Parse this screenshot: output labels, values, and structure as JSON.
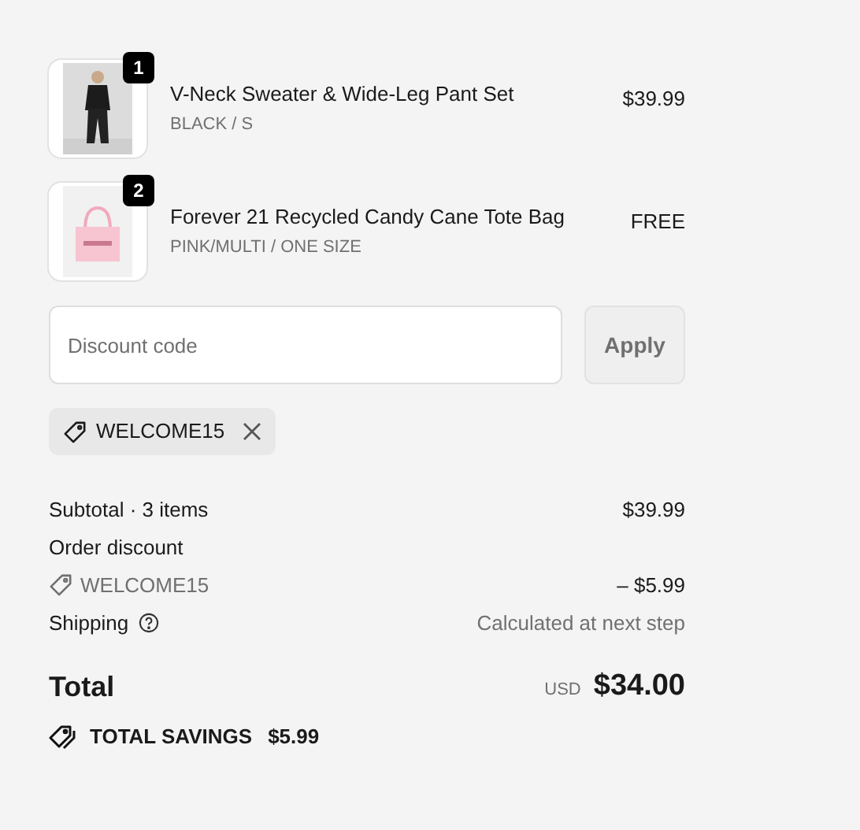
{
  "items": [
    {
      "quantity": "1",
      "name": "V-Neck Sweater & Wide-Leg Pant Set",
      "variant": "BLACK / S",
      "price": "$39.99",
      "kind": "figure"
    },
    {
      "quantity": "2",
      "name": "Forever 21 Recycled Candy Cane Tote Bag",
      "variant": "PINK/MULTI / ONE SIZE",
      "price": "FREE",
      "kind": "bag"
    }
  ],
  "discount": {
    "placeholder": "Discount code",
    "button": "Apply",
    "applied_code": "WELCOME15"
  },
  "summary": {
    "subtotal_label": "Subtotal · 3 items",
    "subtotal": "$39.99",
    "discount_label": "Order discount",
    "discount_code": "WELCOME15",
    "discount_amount": "– $5.99",
    "shipping_label": "Shipping",
    "shipping_value": "Calculated at next step"
  },
  "total": {
    "label": "Total",
    "currency": "USD",
    "amount": "$34.00",
    "savings_label": "TOTAL SAVINGS",
    "savings": "$5.99"
  }
}
